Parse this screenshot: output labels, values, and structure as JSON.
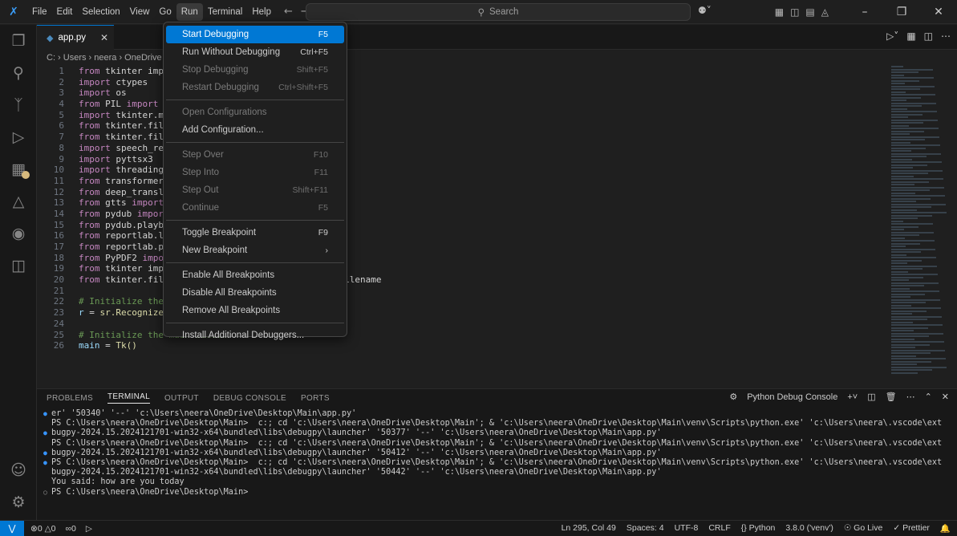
{
  "titlebar": {
    "menu": [
      "File",
      "Edit",
      "Selection",
      "View",
      "Go",
      "Run",
      "Terminal",
      "Help"
    ],
    "search_label": "Search"
  },
  "run_menu": {
    "items": [
      {
        "label": "Start Debugging",
        "shortcut": "F5",
        "state": "selected"
      },
      {
        "label": "Run Without Debugging",
        "shortcut": "Ctrl+F5",
        "state": "enabled"
      },
      {
        "label": "Stop Debugging",
        "shortcut": "Shift+F5",
        "state": "disabled"
      },
      {
        "label": "Restart Debugging",
        "shortcut": "Ctrl+Shift+F5",
        "state": "disabled"
      },
      {
        "sep": true
      },
      {
        "label": "Open Configurations",
        "shortcut": "",
        "state": "disabled"
      },
      {
        "label": "Add Configuration...",
        "shortcut": "",
        "state": "enabled"
      },
      {
        "sep": true
      },
      {
        "label": "Step Over",
        "shortcut": "F10",
        "state": "disabled"
      },
      {
        "label": "Step Into",
        "shortcut": "F11",
        "state": "disabled"
      },
      {
        "label": "Step Out",
        "shortcut": "Shift+F11",
        "state": "disabled"
      },
      {
        "label": "Continue",
        "shortcut": "F5",
        "state": "disabled"
      },
      {
        "sep": true
      },
      {
        "label": "Toggle Breakpoint",
        "shortcut": "F9",
        "state": "enabled"
      },
      {
        "label": "New Breakpoint",
        "shortcut": "›",
        "state": "enabled"
      },
      {
        "sep": true
      },
      {
        "label": "Enable All Breakpoints",
        "shortcut": "",
        "state": "enabled"
      },
      {
        "label": "Disable All Breakpoints",
        "shortcut": "",
        "state": "enabled"
      },
      {
        "label": "Remove All Breakpoints",
        "shortcut": "",
        "state": "enabled"
      },
      {
        "sep": true
      },
      {
        "label": "Install Additional Debuggers...",
        "shortcut": "",
        "state": "enabled"
      }
    ]
  },
  "editor": {
    "tab_label": "app.py",
    "breadcrumb": "C: › Users › neera › OneDrive ›",
    "lines": [
      {
        "n": "1",
        "code": "from tkinter impor"
      },
      {
        "n": "2",
        "code": "import ctypes"
      },
      {
        "n": "3",
        "code": "import os"
      },
      {
        "n": "4",
        "code": "from PIL import Im"
      },
      {
        "n": "5",
        "code": "import tkinter.mes"
      },
      {
        "n": "6",
        "code": "from tkinter.filed"
      },
      {
        "n": "7",
        "code": "from tkinter.filed"
      },
      {
        "n": "8",
        "code": "import speech_reco"
      },
      {
        "n": "9",
        "code": "import pyttsx3"
      },
      {
        "n": "10",
        "code": "import threading a"
      },
      {
        "n": "11",
        "code": "from transformers "
      },
      {
        "n": "12",
        "code": "from deep_translat"
      },
      {
        "n": "13",
        "code": "from gtts import g"
      },
      {
        "n": "14",
        "code": "from pydub import "
      },
      {
        "n": "15",
        "code": "from pydub.playbac"
      },
      {
        "n": "16",
        "code": "from reportlab.lib"
      },
      {
        "n": "17",
        "code": "from reportlab.pdf"
      },
      {
        "n": "18",
        "code": "from PyPDF2 import"
      },
      {
        "n": "19",
        "code": "from tkinter impor"
      },
      {
        "n": "20",
        "code": "from tkinter.filed                              sfilename"
      },
      {
        "n": "21",
        "code": ""
      },
      {
        "n": "22",
        "code": "# Initialize the r"
      },
      {
        "n": "23",
        "code": "r = sr.Recognizer()"
      },
      {
        "n": "24",
        "code": ""
      },
      {
        "n": "25",
        "code": "# Initialize the main window"
      },
      {
        "n": "26",
        "code": "main = Tk()"
      }
    ]
  },
  "panel": {
    "tabs": [
      "PROBLEMS",
      "TERMINAL",
      "OUTPUT",
      "DEBUG CONSOLE",
      "PORTS"
    ],
    "active_tab": "TERMINAL",
    "terminal_name": "Python Debug Console",
    "lines": [
      {
        "dot": "blue",
        "text": "er' '50340' '--' 'c:\\Users\\neera\\OneDrive\\Desktop\\Main\\app.py'"
      },
      {
        "dot": "",
        "text": "PS C:\\Users\\neera\\OneDrive\\Desktop\\Main>  c:; cd 'c:\\Users\\neera\\OneDrive\\Desktop\\Main'; & 'c:\\Users\\neera\\OneDrive\\Desktop\\Main\\venv\\Scripts\\python.exe' 'c:\\Users\\neera\\.vscode\\extensions\\ms-python.de"
      },
      {
        "dot": "blue",
        "text": "bugpy-2024.15.2024121701-win32-x64\\bundled\\libs\\debugpy\\launcher' '50377' '--' 'c:\\Users\\neera\\OneDrive\\Desktop\\Main\\app.py'"
      },
      {
        "dot": "",
        "text": "PS C:\\Users\\neera\\OneDrive\\Desktop\\Main>  c:; cd 'c:\\Users\\neera\\OneDrive\\Desktop\\Main'; & 'c:\\Users\\neera\\OneDrive\\Desktop\\Main\\venv\\Scripts\\python.exe' 'c:\\Users\\neera\\.vscode\\extensions\\ms-python.de"
      },
      {
        "dot": "blue",
        "text": "bugpy-2024.15.2024121701-win32-x64\\bundled\\libs\\debugpy\\launcher' '50412' '--' 'c:\\Users\\neera\\OneDrive\\Desktop\\Main\\app.py'"
      },
      {
        "dot": "blue",
        "text": "PS C:\\Users\\neera\\OneDrive\\Desktop\\Main>  c:; cd 'c:\\Users\\neera\\OneDrive\\Desktop\\Main'; & 'c:\\Users\\neera\\OneDrive\\Desktop\\Main\\venv\\Scripts\\python.exe' 'c:\\Users\\neera\\.vscode\\extensions\\ms-python.de"
      },
      {
        "dot": "",
        "text": "bugpy-2024.15.2024121701-win32-x64\\bundled\\libs\\debugpy\\launcher' '50442' '--' 'c:\\Users\\neera\\OneDrive\\Desktop\\Main\\app.py'"
      },
      {
        "dot": "",
        "text": "You said: how are you today"
      },
      {
        "dot": "grey",
        "text": "PS C:\\Users\\neera\\OneDrive\\Desktop\\Main>"
      }
    ]
  },
  "statusbar": {
    "errors": "0",
    "warnings": "0",
    "ports": "0",
    "position": "Ln 295, Col 49",
    "spaces": "Spaces: 4",
    "encoding": "UTF-8",
    "eol": "CRLF",
    "language": "{} Python",
    "interpreter": "3.8.0 ('venv')",
    "golive": "Go Live",
    "prettier": "Prettier"
  }
}
